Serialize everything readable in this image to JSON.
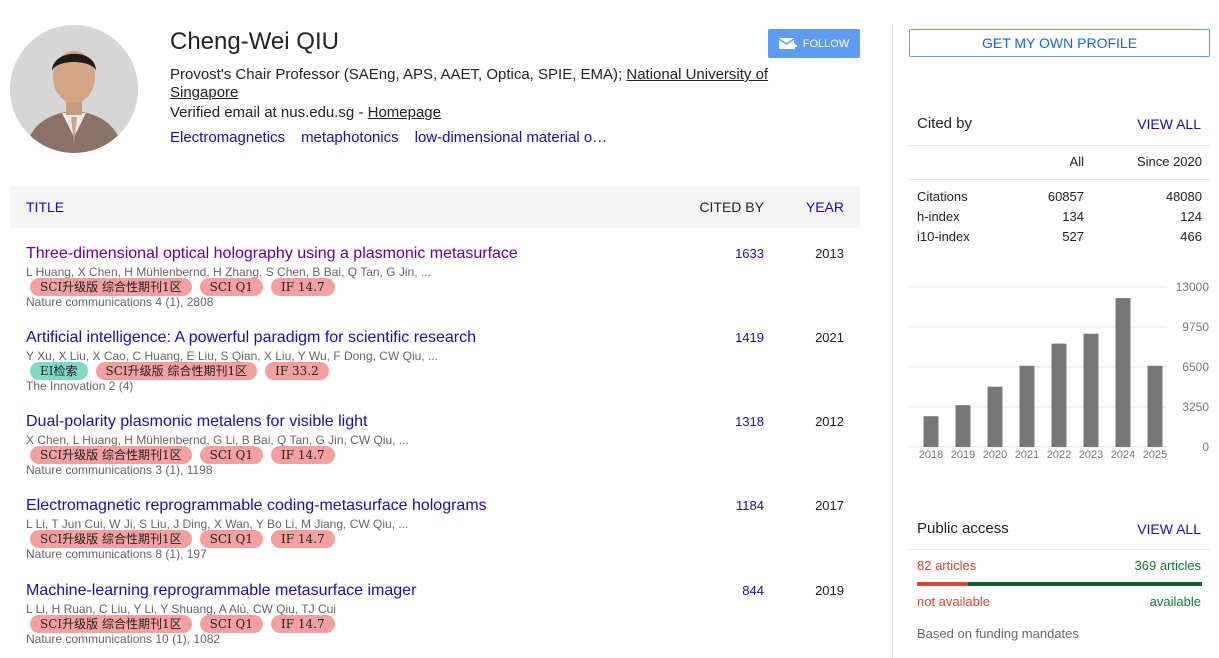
{
  "profile": {
    "name": "Cheng-Wei QIU",
    "affiliation_prefix": "Provost's Chair Professor (SAEng, APS, AAET, Optica, SPIE, EMA); ",
    "institution": "National University of Singapore",
    "email_text": "Verified email at nus.edu.sg - ",
    "homepage": "Homepage",
    "interests": [
      "Electromagnetics",
      "metaphotonics",
      "low-dimensional material o…"
    ],
    "follow_label": "FOLLOW"
  },
  "table": {
    "headers": {
      "title": "TITLE",
      "cited_by": "CITED BY",
      "year": "YEAR"
    },
    "rows": [
      {
        "title": "Three-dimensional optical holography using a plasmonic metasurface",
        "authors": "L Huang, X Chen, H Mühlenbernd, H Zhang, S Chen, B Bai, Q Tan, G Jin, ...",
        "tags": [
          {
            "text": "SCI升级版 综合性期刊1区",
            "color": "red"
          },
          {
            "text": "SCI Q1",
            "color": "red"
          },
          {
            "text": "IF 14.7",
            "color": "red"
          }
        ],
        "venue": "Nature communications 4 (1), 2808",
        "cited_by": "1633",
        "year": "2013",
        "visited": true
      },
      {
        "title": "Artificial intelligence: A powerful paradigm for scientific research",
        "authors": "Y Xu, X Liu, X Cao, C Huang, E Liu, S Qian, X Liu, Y Wu, F Dong, CW Qiu, ...",
        "tags": [
          {
            "text": "EI检索",
            "color": "green"
          },
          {
            "text": "SCI升级版 综合性期刊1区",
            "color": "red"
          },
          {
            "text": "IF 33.2",
            "color": "red"
          }
        ],
        "venue": "The Innovation 2 (4)",
        "cited_by": "1419",
        "year": "2021",
        "visited": false
      },
      {
        "title": "Dual-polarity plasmonic metalens for visible light",
        "authors": "X Chen, L Huang, H Mühlenbernd, G Li, B Bai, Q Tan, G Jin, CW Qiu, ...",
        "tags": [
          {
            "text": "SCI升级版 综合性期刊1区",
            "color": "red"
          },
          {
            "text": "SCI Q1",
            "color": "red"
          },
          {
            "text": "IF 14.7",
            "color": "red"
          }
        ],
        "venue": "Nature communications 3 (1), 1198",
        "cited_by": "1318",
        "year": "2012",
        "visited": false
      },
      {
        "title": "Electromagnetic reprogrammable coding-metasurface holograms",
        "authors": "L Li, T Jun Cui, W Ji, S Liu, J Ding, X Wan, Y Bo Li, M Jiang, CW Qiu, ...",
        "tags": [
          {
            "text": "SCI升级版 综合性期刊1区",
            "color": "red"
          },
          {
            "text": "SCI Q1",
            "color": "red"
          },
          {
            "text": "IF 14.7",
            "color": "red"
          }
        ],
        "venue": "Nature communications 8 (1), 197",
        "cited_by": "1184",
        "year": "2017",
        "visited": false
      },
      {
        "title": "Machine-learning reprogrammable metasurface imager",
        "authors": "L Li, H Ruan, C Liu, Y Li, Y Shuang, A Alù, CW Qiu, TJ Cui",
        "tags": [
          {
            "text": "SCI升级版 综合性期刊1区",
            "color": "red"
          },
          {
            "text": "SCI Q1",
            "color": "red"
          },
          {
            "text": "IF 14.7",
            "color": "red"
          }
        ],
        "venue": "Nature communications 10 (1), 1082",
        "cited_by": "844",
        "year": "2019",
        "visited": false
      }
    ]
  },
  "sidebar": {
    "own_profile_label": "GET MY OWN PROFILE",
    "cited_by": {
      "title": "Cited by",
      "view_all": "VIEW ALL",
      "col_all": "All",
      "col_since": "Since 2020",
      "rows": [
        {
          "label": "Citations",
          "all": "60857",
          "since": "48080"
        },
        {
          "label": "h-index",
          "all": "134",
          "since": "124"
        },
        {
          "label": "i10-index",
          "all": "527",
          "since": "466"
        }
      ]
    },
    "public_access": {
      "title": "Public access",
      "view_all": "VIEW ALL",
      "not_available_count": "82 articles",
      "available_count": "369 articles",
      "not_available_label": "not available",
      "available_label": "available",
      "footer": "Based on funding mandates"
    }
  },
  "chart_data": {
    "type": "bar",
    "categories": [
      "2018",
      "2019",
      "2020",
      "2021",
      "2022",
      "2023",
      "2024",
      "2025"
    ],
    "values": [
      2500,
      3400,
      4900,
      6600,
      8400,
      9200,
      12100,
      6600
    ],
    "yticks": [
      "13000",
      "9750",
      "6500",
      "3250",
      "0"
    ],
    "ylim": [
      0,
      13000
    ],
    "bar_color": "#777777"
  }
}
